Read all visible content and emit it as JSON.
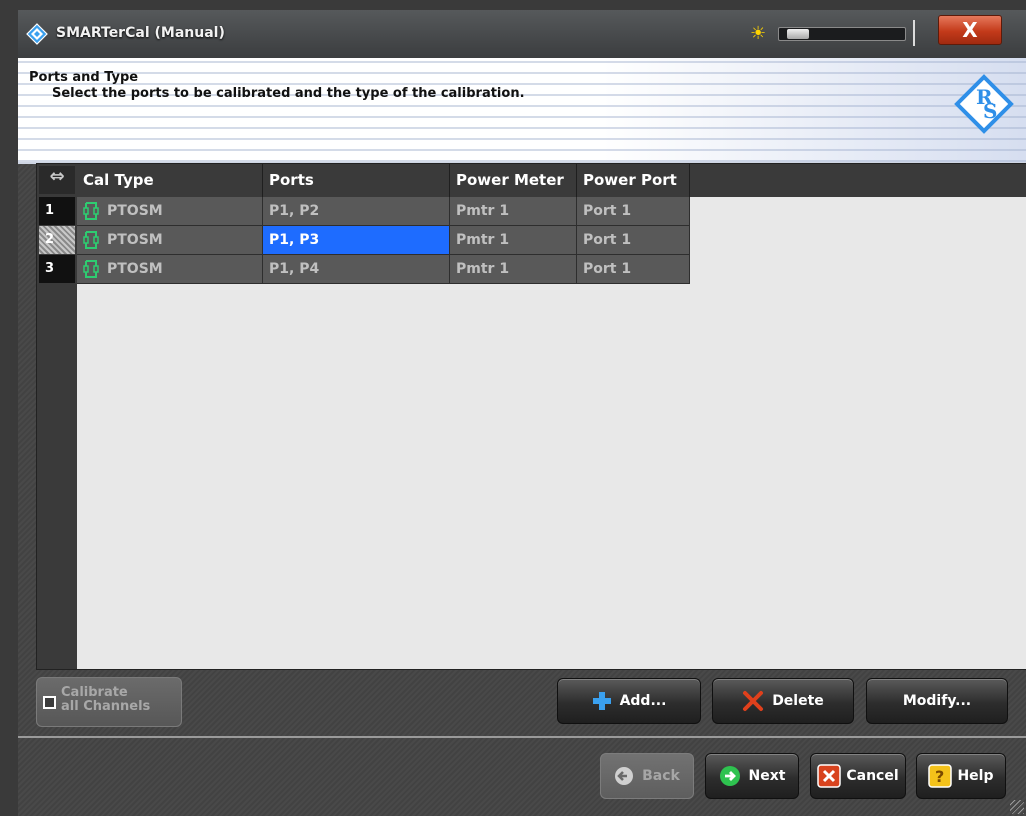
{
  "window": {
    "title": "SMARTerCal (Manual)",
    "close_label": "X"
  },
  "header": {
    "title": "Ports and Type",
    "description": "Select the ports to be calibrated and the type of the calibration."
  },
  "table": {
    "corner_symbol": "⇔",
    "columns": [
      "Cal Type",
      "Ports",
      "Power Meter",
      "Power Port"
    ],
    "rows": [
      {
        "num": "1",
        "cal_type": "PTOSM",
        "ports": "P1, P2",
        "power_meter": "Pmtr 1",
        "power_port": "Port 1"
      },
      {
        "num": "2",
        "cal_type": "PTOSM",
        "ports": "P1, P3",
        "power_meter": "Pmtr 1",
        "power_port": "Port 1"
      },
      {
        "num": "3",
        "cal_type": "PTOSM",
        "ports": "P1, P4",
        "power_meter": "Pmtr 1",
        "power_port": "Port 1"
      }
    ],
    "selected_row": 2
  },
  "options": {
    "calibrate_all_line1": "Calibrate",
    "calibrate_all_line2": "all Channels",
    "calibrate_all_checked": false
  },
  "actions": {
    "add": "Add...",
    "delete": "Delete",
    "modify": "Modify..."
  },
  "nav": {
    "back": "Back",
    "next": "Next",
    "cancel": "Cancel",
    "help": "Help"
  },
  "colors": {
    "selection": "#1e6cff",
    "caltype_icon": "#2ecc71",
    "accent_blue": "#2f8fe8"
  }
}
